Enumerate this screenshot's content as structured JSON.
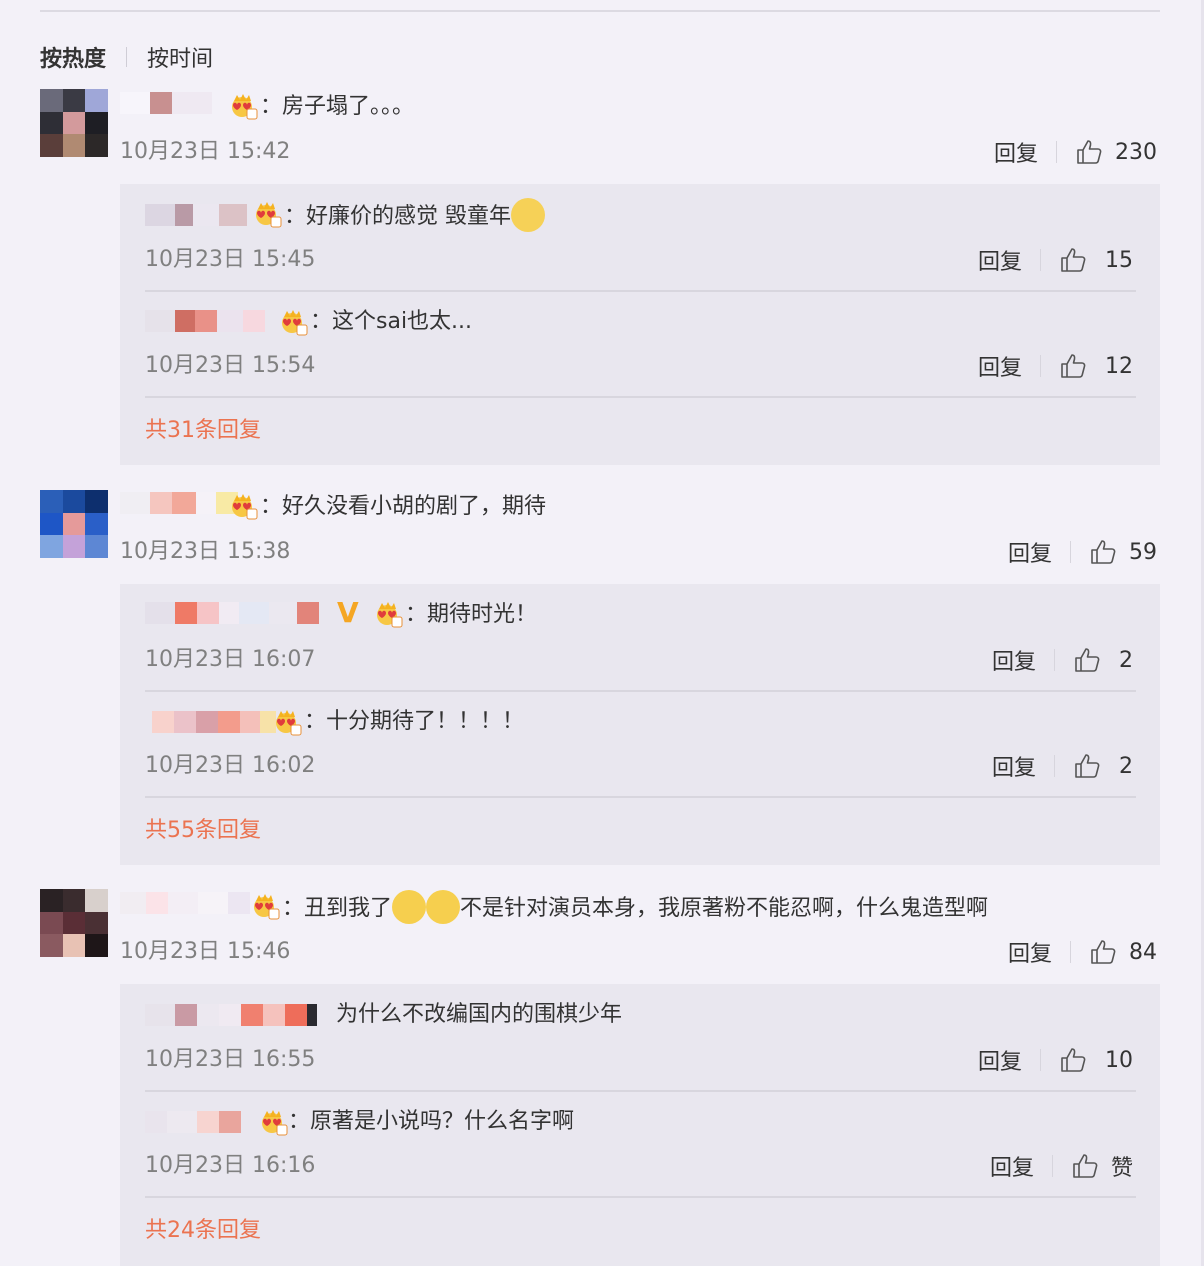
{
  "sort": {
    "hot": "按热度",
    "time": "按时间"
  },
  "reply_label": "回复",
  "comments": [
    {
      "text": "：房子塌了。。。",
      "time": "10月23日 15:42",
      "likes": "230",
      "replies": [
        {
          "text": "：好廉价的感觉 毁童年",
          "time": "10月23日 15:45",
          "likes": "15"
        },
        {
          "text": "：这个sai也太...",
          "time": "10月23日 15:54",
          "likes": "12"
        }
      ],
      "more": "共31条回复"
    },
    {
      "text": "：好久没看小胡的剧了，期待",
      "time": "10月23日 15:38",
      "likes": "59",
      "replies": [
        {
          "text": "：期待时光！",
          "time": "10月23日 16:07",
          "likes": "2"
        },
        {
          "text": "：十分期待了！！！！",
          "time": "10月23日 16:02",
          "likes": "2"
        }
      ],
      "more": "共55条回复"
    },
    {
      "text_a": "：丑到我了",
      "text_b": "不是针对演员本身，我原著粉不能忍啊，什么鬼造型啊",
      "time": "10月23日 15:46",
      "likes": "84",
      "replies": [
        {
          "text": "为什么不改编国内的围棋少年",
          "time": "10月23日 16:55",
          "likes": "10"
        },
        {
          "text": "：原著是小说吗？什么名字啊",
          "time": "10月23日 16:16",
          "likes": "赞"
        }
      ],
      "more": "共24条回复"
    }
  ],
  "colors": {
    "accent": "#eb7350",
    "text": "#333333",
    "muted": "#808080",
    "reply_bg": "#e9e7ef",
    "page_bg": "#f3f1f8"
  },
  "icons": {
    "like": "thumbs-up-icon",
    "badge": "crown-member-badge-icon",
    "verified": "v-verified-icon",
    "emoji_laugh": "laugh-cry-emoji-icon",
    "emoji_think": "thinking-emoji-icon"
  }
}
